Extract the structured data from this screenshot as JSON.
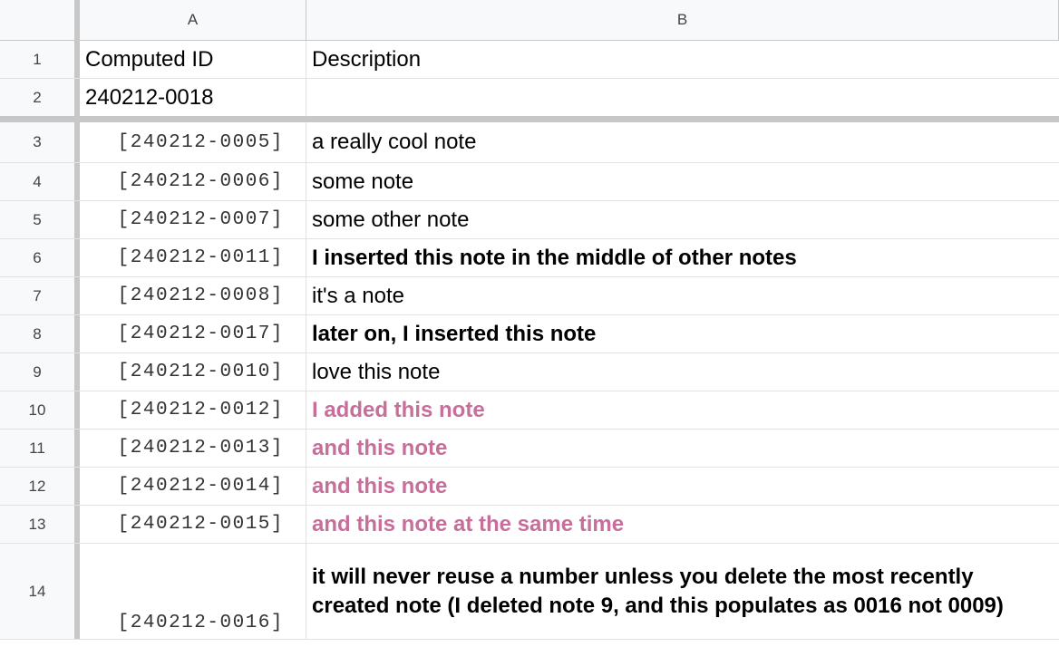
{
  "columns": {
    "a": "A",
    "b": "B"
  },
  "rows": [
    {
      "num": "1",
      "a": "Computed ID",
      "b": "Description"
    },
    {
      "num": "2",
      "a": "240212-0018",
      "b": ""
    },
    {
      "num": "3",
      "a": "[240212-0005]",
      "b": "a really cool note"
    },
    {
      "num": "4",
      "a": "[240212-0006]",
      "b": "some note"
    },
    {
      "num": "5",
      "a": "[240212-0007]",
      "b": "some other note"
    },
    {
      "num": "6",
      "a": "[240212-0011]",
      "b": "I inserted this note in the middle of other notes"
    },
    {
      "num": "7",
      "a": "[240212-0008]",
      "b": "it's a note"
    },
    {
      "num": "8",
      "a": "[240212-0017]",
      "b": "later on, I inserted this note"
    },
    {
      "num": "9",
      "a": "[240212-0010]",
      "b": "love this note"
    },
    {
      "num": "10",
      "a": "[240212-0012]",
      "b": "I added this note"
    },
    {
      "num": "11",
      "a": "[240212-0013]",
      "b": "and this note"
    },
    {
      "num": "12",
      "a": "[240212-0014]",
      "b": "and this note"
    },
    {
      "num": "13",
      "a": "[240212-0015]",
      "b": "and this note at the same time"
    },
    {
      "num": "14",
      "a": "[240212-0016]",
      "b": "it will never reuse a number unless you delete the most recently created note (I deleted note 9, and this populates as 0016 not 0009)"
    }
  ],
  "colors": {
    "highlight_text": "#c76e9b",
    "grid_line": "#e2e2e2",
    "header_bg": "#f8f9fa"
  }
}
